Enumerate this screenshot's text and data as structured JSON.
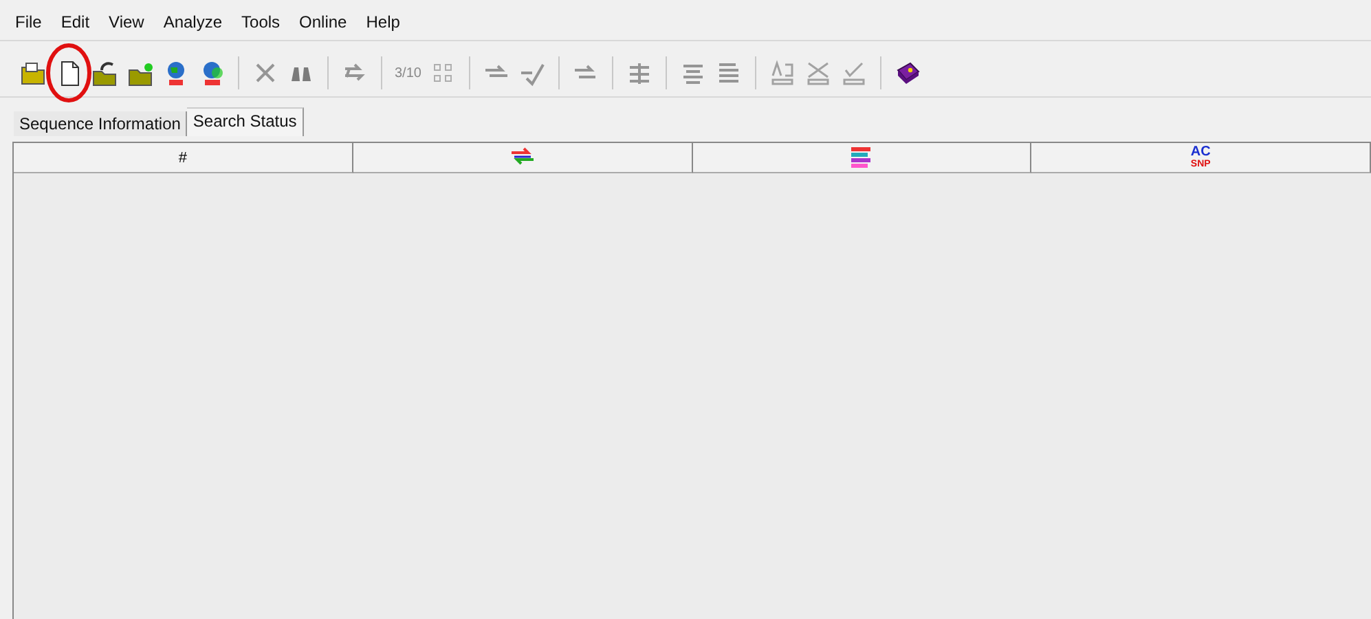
{
  "menu": [
    "File",
    "Edit",
    "View",
    "Analyze",
    "Tools",
    "Online",
    "Help"
  ],
  "toolbar": [
    {
      "kind": "icon",
      "disabled": false,
      "highlighted": false
    },
    {
      "kind": "icon",
      "disabled": false,
      "highlighted": true
    },
    {
      "kind": "icon",
      "disabled": false,
      "highlighted": false
    },
    {
      "kind": "icon",
      "disabled": false,
      "highlighted": false
    },
    {
      "kind": "icon",
      "disabled": false,
      "highlighted": false
    },
    {
      "kind": "icon",
      "disabled": false,
      "highlighted": false
    },
    {
      "kind": "separator"
    },
    {
      "kind": "icon",
      "disabled": true,
      "highlighted": false
    },
    {
      "kind": "icon",
      "disabled": true,
      "highlighted": false
    },
    {
      "kind": "separator"
    },
    {
      "kind": "icon",
      "disabled": true,
      "highlighted": false
    },
    {
      "kind": "separator"
    },
    {
      "kind": "text",
      "label": "3/10",
      "disabled": true
    },
    {
      "kind": "icon",
      "disabled": true,
      "highlighted": false
    },
    {
      "kind": "separator"
    },
    {
      "kind": "icon",
      "disabled": true,
      "highlighted": false
    },
    {
      "kind": "icon",
      "disabled": true,
      "highlighted": false
    },
    {
      "kind": "separator"
    },
    {
      "kind": "icon",
      "disabled": true,
      "highlighted": false
    },
    {
      "kind": "separator"
    },
    {
      "kind": "icon",
      "disabled": true,
      "highlighted": false
    },
    {
      "kind": "separator"
    },
    {
      "kind": "icon",
      "disabled": true,
      "highlighted": false
    },
    {
      "kind": "icon",
      "disabled": true,
      "highlighted": false
    },
    {
      "kind": "separator"
    },
    {
      "kind": "icon",
      "disabled": true,
      "highlighted": false
    },
    {
      "kind": "icon",
      "disabled": true,
      "highlighted": false
    },
    {
      "kind": "icon",
      "disabled": true,
      "highlighted": false
    },
    {
      "kind": "separator"
    },
    {
      "kind": "icon",
      "disabled": false,
      "highlighted": false
    }
  ],
  "tabs": [
    {
      "label": "Sequence Information",
      "selected": false
    },
    {
      "label": "Search Status",
      "selected": true
    }
  ],
  "table": {
    "columns": [
      {
        "kind": "text",
        "label": "#"
      },
      {
        "kind": "icon"
      },
      {
        "kind": "icon"
      },
      {
        "kind": "stacked",
        "lines": [
          "AC",
          "SNP"
        ]
      }
    ]
  }
}
